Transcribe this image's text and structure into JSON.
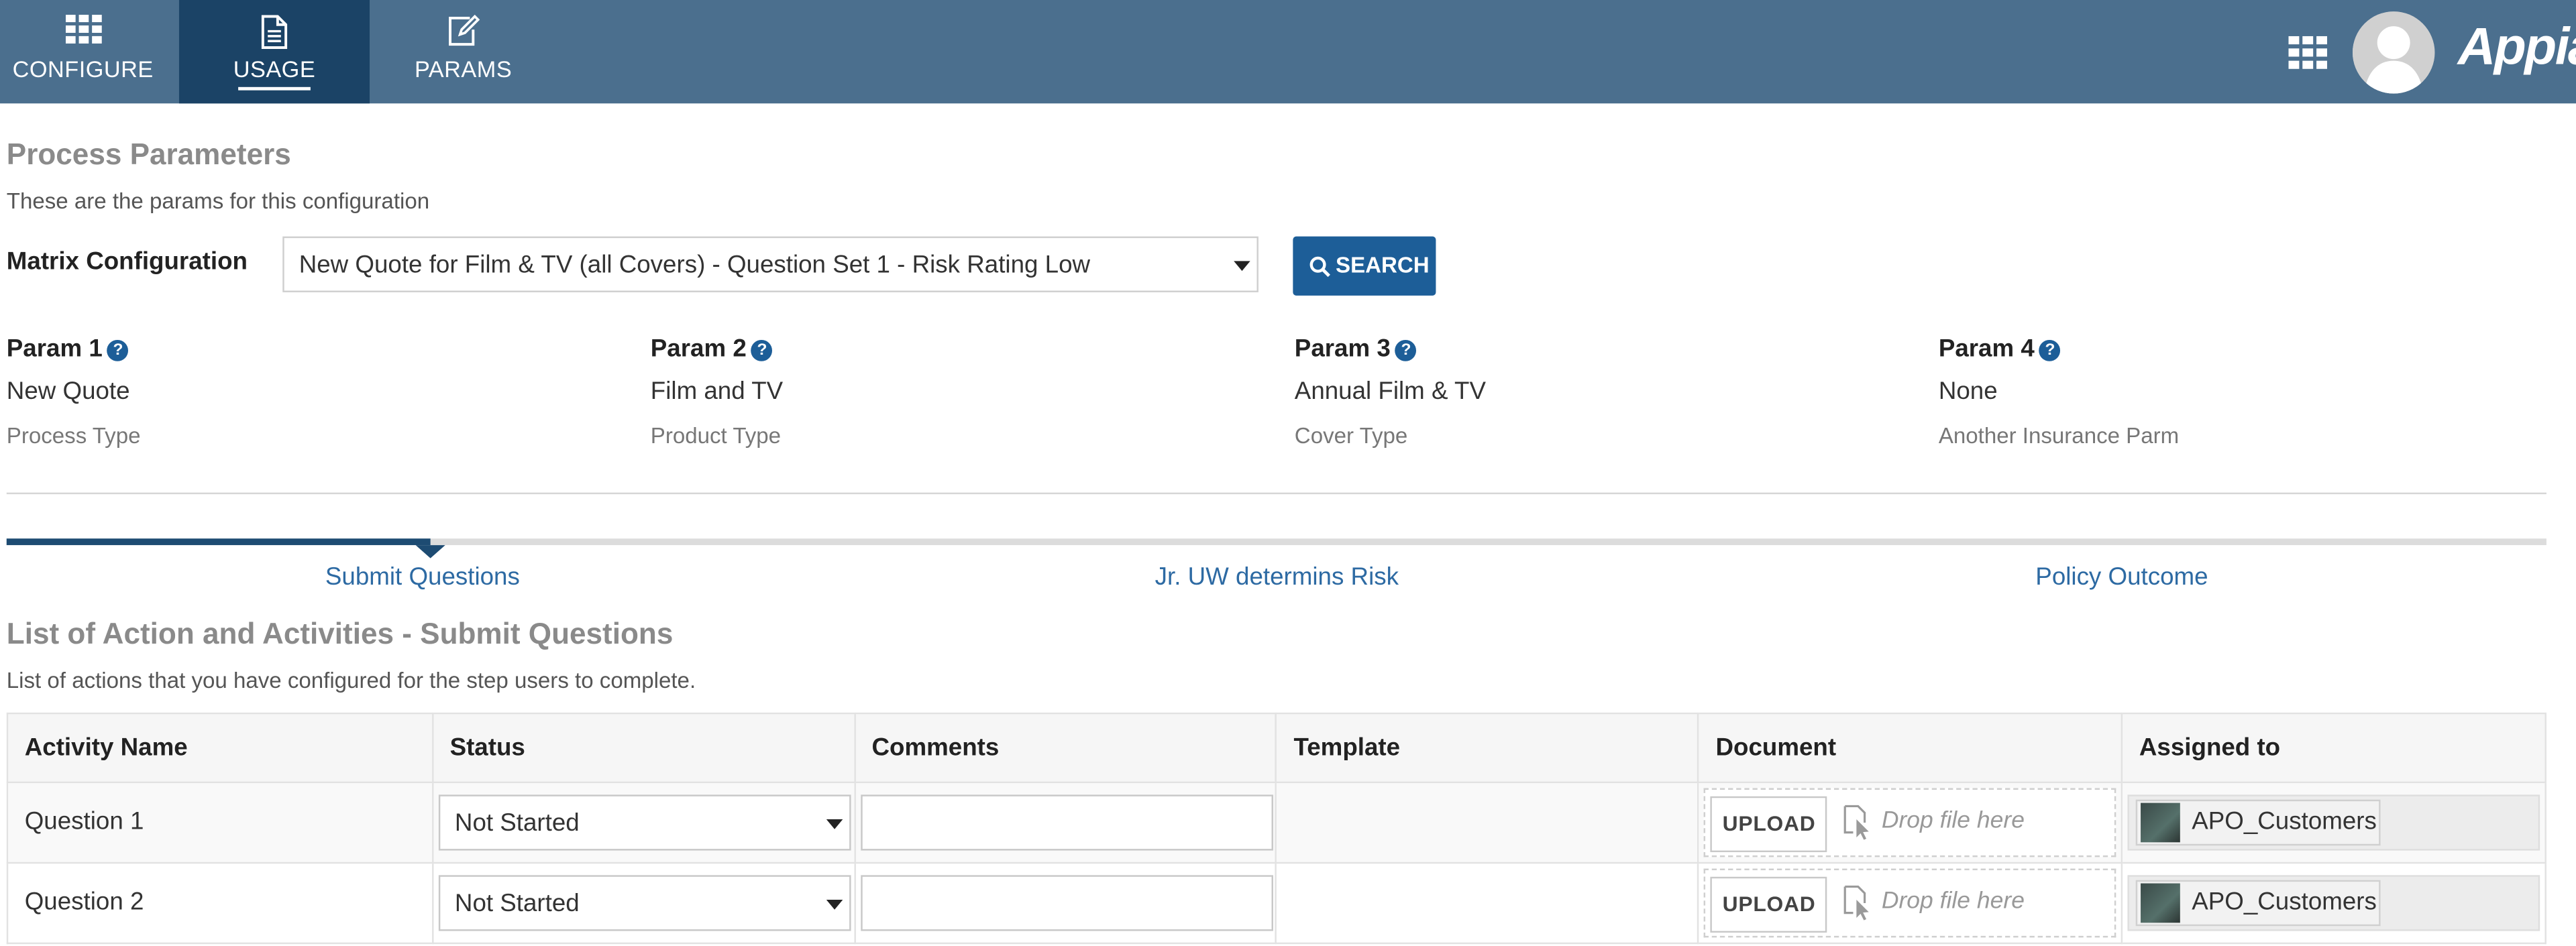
{
  "nav": {
    "tabs": [
      {
        "label": "CONFIGURE",
        "icon": "grid-icon"
      },
      {
        "label": "USAGE",
        "icon": "document-icon"
      },
      {
        "label": "PARAMS",
        "icon": "edit-icon"
      }
    ],
    "brand": "Appian"
  },
  "process_parameters": {
    "title": "Process Parameters",
    "subtitle": "These are the params for this configuration",
    "matrix_label": "Matrix Configuration",
    "matrix_value": "New Quote for Film & TV (all Covers) - Question Set 1 - Risk Rating Low",
    "search_label": "SEARCH",
    "params": [
      {
        "name": "Param 1",
        "value": "New Quote",
        "desc": "Process Type"
      },
      {
        "name": "Param 2",
        "value": "Film and TV",
        "desc": "Product Type"
      },
      {
        "name": "Param 3",
        "value": "Annual Film & TV",
        "desc": "Cover Type"
      },
      {
        "name": "Param 4",
        "value": "None",
        "desc": "Another Insurance Parm"
      }
    ],
    "help_glyph": "?"
  },
  "milestones": {
    "steps": [
      "Submit Questions",
      "Jr. UW determins Risk",
      "Policy Outcome"
    ],
    "active_index": 0
  },
  "activities": {
    "title": "List of Action and Activities - Submit Questions",
    "subtitle": "List of actions that you have configured for the step users to complete.",
    "columns": [
      "Activity Name",
      "Status",
      "Comments",
      "Template",
      "Document",
      "Assigned to"
    ],
    "rows": [
      {
        "activity": "Question 1",
        "status": "Not Started",
        "comments": "",
        "template": "",
        "assigned": "APO_Customers"
      },
      {
        "activity": "Question 2",
        "status": "Not Started",
        "comments": "",
        "template": "",
        "assigned": "APO_Customers"
      }
    ],
    "upload_label": "UPLOAD",
    "drop_label": "Drop file here"
  },
  "colors": {
    "topbar": "#4b6f8e",
    "active_tab": "#1b4366",
    "accent": "#1d5e98",
    "milestone_active": "#1d4b72"
  }
}
